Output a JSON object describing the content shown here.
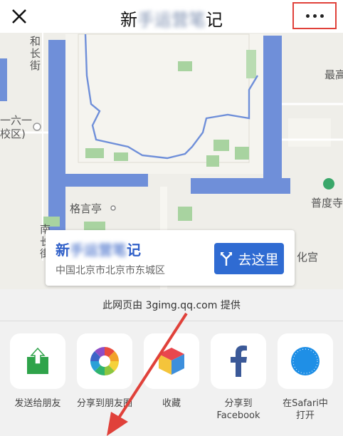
{
  "header": {
    "title_prefix": "新",
    "title_blurred": "手运营笔",
    "title_suffix": "记",
    "close_icon": "close-icon",
    "more_icon": "more-icon",
    "highlight_color": "#e0413a"
  },
  "map": {
    "labels": {
      "street_top_left": "和长街",
      "left_text_1": "一六一",
      "left_text_2": "校区)",
      "right_top": "最高",
      "pudu_temple": "普度寺",
      "geyan_pavilion": "格言亭",
      "left_vertical": "南长街",
      "right_lower": "化宫"
    }
  },
  "popup": {
    "title_prefix": "新",
    "title_blurred": "手运营笔",
    "title_suffix": "记",
    "address": "中国北京市北京市东城区",
    "go_button": "去这里",
    "accent_color": "#2f6bd2"
  },
  "share_sheet": {
    "provider_text": "此网页由 3gimg.qq.com 提供",
    "items": [
      {
        "label": "发送给朋友",
        "icon": "send-to-friend-icon"
      },
      {
        "label": "分享到朋友圈",
        "icon": "moments-icon"
      },
      {
        "label": "收藏",
        "icon": "favorite-cube-icon"
      },
      {
        "label": "分享到\nFacebook",
        "icon": "facebook-icon"
      },
      {
        "label": "在Safari中\n打开",
        "icon": "safari-compass-icon"
      }
    ]
  },
  "annotation": {
    "arrow_color": "#e0413a"
  }
}
